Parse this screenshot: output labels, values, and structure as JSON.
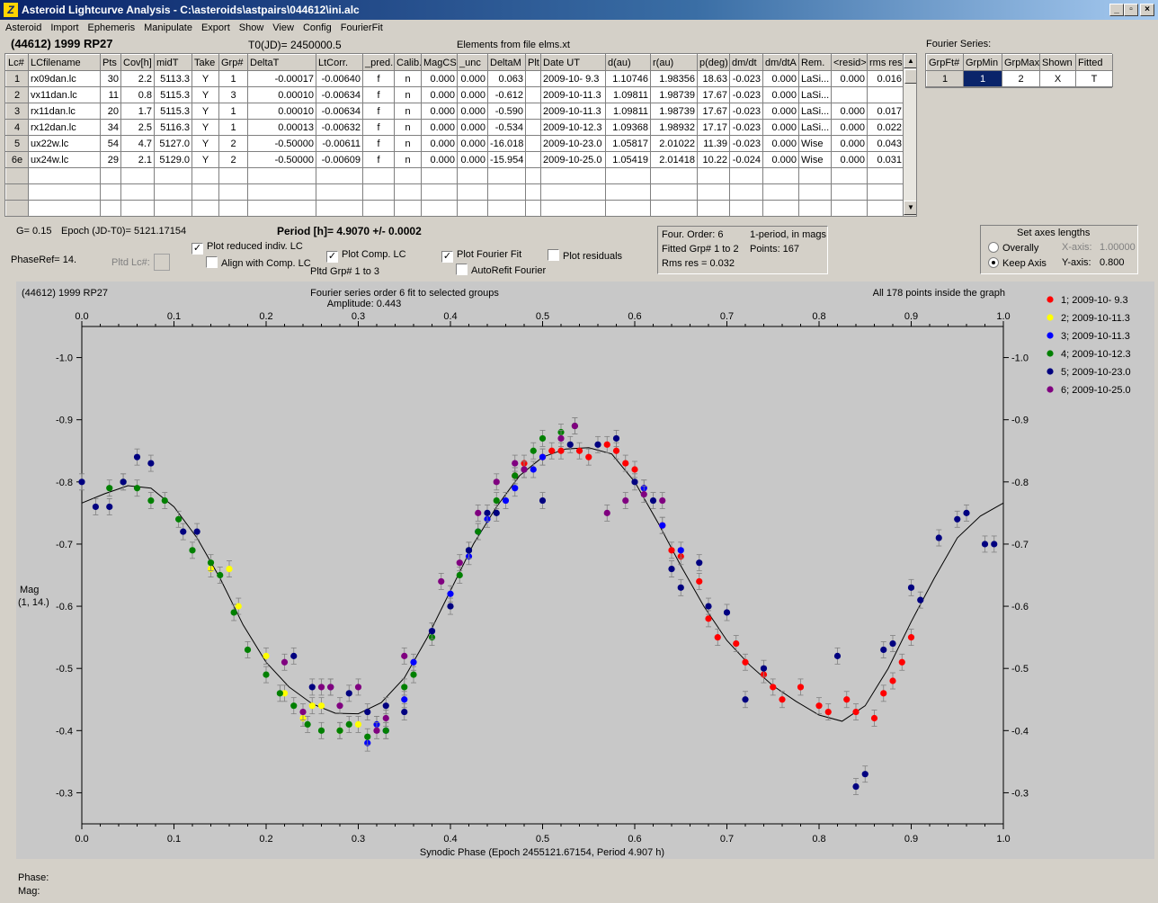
{
  "window": {
    "title": "Asteroid Lightcurve Analysis - C:\\asteroids\\astpairs\\044612\\ini.alc",
    "icon": "app-icon",
    "min": "_",
    "max": "▫",
    "close": "×"
  },
  "menu": [
    "Asteroid",
    "Import",
    "Ephemeris",
    "Manipulate",
    "Export",
    "Show",
    "View",
    "Config",
    "FourierFit"
  ],
  "header": {
    "asteroid": "(44612) 1999 RP27",
    "t0": "T0(JD)= 2450000.5",
    "elements": "Elements from file elms.xt"
  },
  "lc_table": {
    "headers": [
      "Lc#",
      "LCfilename",
      "Pts",
      "Cov[h]",
      "midT",
      "Take",
      "Grp#",
      "DeltaT",
      "LtCorr.",
      "_pred.",
      "Calib.",
      "MagCS",
      "_unc",
      "DeltaM",
      "Plt",
      "Date UT",
      "d(au)",
      "r(au)",
      "p(deg)",
      "dm/dt",
      "dm/dtA",
      "Rem.",
      "<resid>",
      "rms res"
    ],
    "rows": [
      [
        "1",
        "rx09dan.lc",
        "30",
        "2.2",
        "5113.3",
        "Y",
        "1",
        "-0.00017",
        "-0.00640",
        "f",
        "n",
        "0.000",
        "0.000",
        "0.063",
        "",
        "2009-10- 9.3",
        "1.10746",
        "1.98356",
        "18.63",
        "-0.023",
        "0.000",
        "LaSi...",
        "0.000",
        "0.016"
      ],
      [
        "2",
        "vx11dan.lc",
        "11",
        "0.8",
        "5115.3",
        "Y",
        "3",
        "0.00010",
        "-0.00634",
        "f",
        "n",
        "0.000",
        "0.000",
        "-0.612",
        "",
        "2009-10-11.3",
        "1.09811",
        "1.98739",
        "17.67",
        "-0.023",
        "0.000",
        "LaSi...",
        "",
        ""
      ],
      [
        "3",
        "rx11dan.lc",
        "20",
        "1.7",
        "5115.3",
        "Y",
        "1",
        "0.00010",
        "-0.00634",
        "f",
        "n",
        "0.000",
        "0.000",
        "-0.590",
        "",
        "2009-10-11.3",
        "1.09811",
        "1.98739",
        "17.67",
        "-0.023",
        "0.000",
        "LaSi...",
        "0.000",
        "0.017"
      ],
      [
        "4",
        "rx12dan.lc",
        "34",
        "2.5",
        "5116.3",
        "Y",
        "1",
        "0.00013",
        "-0.00632",
        "f",
        "n",
        "0.000",
        "0.000",
        "-0.534",
        "",
        "2009-10-12.3",
        "1.09368",
        "1.98932",
        "17.17",
        "-0.023",
        "0.000",
        "LaSi...",
        "0.000",
        "0.022"
      ],
      [
        "5",
        "ux22w.lc",
        "54",
        "4.7",
        "5127.0",
        "Y",
        "2",
        "-0.50000",
        "-0.00611",
        "f",
        "n",
        "0.000",
        "0.000",
        "-16.018",
        "",
        "2009-10-23.0",
        "1.05817",
        "2.01022",
        "11.39",
        "-0.023",
        "0.000",
        "Wise",
        "0.000",
        "0.043"
      ],
      [
        "6e",
        "ux24w.lc",
        "29",
        "2.1",
        "5129.0",
        "Y",
        "2",
        "-0.50000",
        "-0.00609",
        "f",
        "n",
        "0.000",
        "0.000",
        "-15.954",
        "",
        "2009-10-25.0",
        "1.05419",
        "2.01418",
        "10.22",
        "-0.024",
        "0.000",
        "Wise",
        "0.000",
        "0.031"
      ]
    ],
    "empty_rows": 3,
    "scroll_up": "▲",
    "scroll_down": "▼"
  },
  "fourier_panel": {
    "title": "Fourier Series:",
    "headers": [
      "GrpFt#",
      "GrpMin",
      "GrpMax",
      "Shown",
      "Fitted"
    ],
    "row": [
      "1",
      "1",
      "2",
      "X",
      "T"
    ]
  },
  "controls": {
    "g": "G= 0.15",
    "epoch": "Epoch (JD-T0)= 5121.17154",
    "period": "Period [h]= 4.9070 +/- 0.0002",
    "phaseref": "PhaseRef= 14.",
    "pltd_lc": "Pltd Lc#:",
    "plot_reduced": "Plot reduced indiv. LC",
    "align_comp": "Align with Comp. LC",
    "plot_comp": "Plot Comp. LC",
    "pltd_grp": "Pltd Grp#  1   to   3",
    "plot_fourier": "Plot Fourier Fit",
    "autorefit": "AutoRefit Fourier",
    "plot_residuals": "Plot residuals",
    "check": "✓"
  },
  "fit_info": {
    "order": "Four. Order:  6",
    "period_mode": "1-period, in mags",
    "fitted": "Fitted Grp# 1 to 2",
    "points": "Points: 167",
    "rms": "Rms res     = 0.032"
  },
  "axes_box": {
    "title": "Set axes lengths",
    "overally": "Overally",
    "keep": "Keep Axis",
    "xaxis_label": "X-axis:",
    "xaxis_val": "1.00000",
    "yaxis_label": "Y-axis:",
    "yaxis_val": "0.800"
  },
  "chart_data": {
    "type": "scatter",
    "title_left": "(44612) 1999 RP27",
    "title": "Fourier series order 6 fit to selected groups",
    "subtitle": "Amplitude: 0.443",
    "note": "All 178 points inside the graph",
    "xlabel": "Synodic Phase (Epoch 2455121.67154, Period 4.907 h)",
    "ylabel": "Mag",
    "ylabel2": "(1, 14.)",
    "xlim": [
      0,
      1
    ],
    "ylim": [
      -1.05,
      -0.25
    ],
    "y_inverted": true,
    "xticks": [
      0,
      0.1,
      0.2,
      0.3,
      0.4,
      0.5,
      0.6,
      0.7,
      0.8,
      0.9,
      1.0
    ],
    "xtick_labels": [
      "0.0",
      "0.1",
      "0.2",
      "0.3",
      "0.4",
      "0.5",
      "0.6",
      "0.7",
      "0.8",
      "0.9",
      "1.0"
    ],
    "yticks": [
      -1.0,
      -0.9,
      -0.8,
      -0.7,
      -0.6,
      -0.5,
      -0.4,
      -0.3
    ],
    "ytick_labels": [
      "-1.0",
      "-0.9",
      "-0.8",
      "-0.7",
      "-0.6",
      "-0.5",
      "-0.4",
      "-0.3"
    ],
    "legend": "right",
    "series": [
      {
        "name": "1; 2009-10- 9.3",
        "color": "#ff0000",
        "points": [
          [
            0.47,
            -0.81
          ],
          [
            0.48,
            -0.83
          ],
          [
            0.5,
            -0.84
          ],
          [
            0.51,
            -0.85
          ],
          [
            0.52,
            -0.85
          ],
          [
            0.54,
            -0.85
          ],
          [
            0.55,
            -0.84
          ],
          [
            0.57,
            -0.86
          ],
          [
            0.58,
            -0.85
          ],
          [
            0.59,
            -0.83
          ],
          [
            0.6,
            -0.82
          ],
          [
            0.61,
            -0.79
          ],
          [
            0.63,
            -0.73
          ],
          [
            0.64,
            -0.69
          ],
          [
            0.65,
            -0.68
          ],
          [
            0.67,
            -0.64
          ],
          [
            0.68,
            -0.58
          ],
          [
            0.69,
            -0.55
          ],
          [
            0.71,
            -0.54
          ],
          [
            0.72,
            -0.51
          ],
          [
            0.74,
            -0.49
          ],
          [
            0.75,
            -0.47
          ],
          [
            0.76,
            -0.45
          ],
          [
            0.78,
            -0.47
          ],
          [
            0.8,
            -0.44
          ],
          [
            0.81,
            -0.43
          ],
          [
            0.83,
            -0.45
          ],
          [
            0.84,
            -0.43
          ],
          [
            0.86,
            -0.42
          ],
          [
            0.87,
            -0.46
          ],
          [
            0.88,
            -0.48
          ],
          [
            0.89,
            -0.51
          ],
          [
            0.9,
            -0.55
          ]
        ]
      },
      {
        "name": "2; 2009-10-11.3",
        "color": "#ffff00",
        "points": [
          [
            0.14,
            -0.66
          ],
          [
            0.16,
            -0.66
          ],
          [
            0.17,
            -0.6
          ],
          [
            0.2,
            -0.52
          ],
          [
            0.22,
            -0.46
          ],
          [
            0.24,
            -0.42
          ],
          [
            0.25,
            -0.44
          ],
          [
            0.26,
            -0.44
          ],
          [
            0.28,
            -0.4
          ],
          [
            0.3,
            -0.41
          ],
          [
            0.32,
            -0.41
          ]
        ]
      },
      {
        "name": "3; 2009-10-11.3",
        "color": "#0000ff",
        "points": [
          [
            0.33,
            -0.4
          ],
          [
            0.35,
            -0.45
          ],
          [
            0.36,
            -0.51
          ],
          [
            0.38,
            -0.56
          ],
          [
            0.4,
            -0.62
          ],
          [
            0.42,
            -0.68
          ],
          [
            0.43,
            -0.72
          ],
          [
            0.44,
            -0.74
          ],
          [
            0.46,
            -0.77
          ],
          [
            0.47,
            -0.79
          ],
          [
            0.49,
            -0.82
          ],
          [
            0.5,
            -0.84
          ],
          [
            0.61,
            -0.79
          ],
          [
            0.63,
            -0.73
          ],
          [
            0.65,
            -0.69
          ],
          [
            0.31,
            -0.38
          ],
          [
            0.32,
            -0.41
          ]
        ]
      },
      {
        "name": "4; 2009-10-12.3",
        "color": "#008000",
        "points": [
          [
            0.03,
            -0.79
          ],
          [
            0.045,
            -0.8
          ],
          [
            0.06,
            -0.79
          ],
          [
            0.075,
            -0.77
          ],
          [
            0.09,
            -0.77
          ],
          [
            0.105,
            -0.74
          ],
          [
            0.12,
            -0.69
          ],
          [
            0.14,
            -0.67
          ],
          [
            0.15,
            -0.65
          ],
          [
            0.165,
            -0.59
          ],
          [
            0.18,
            -0.53
          ],
          [
            0.2,
            -0.49
          ],
          [
            0.215,
            -0.46
          ],
          [
            0.23,
            -0.44
          ],
          [
            0.245,
            -0.41
          ],
          [
            0.26,
            -0.4
          ],
          [
            0.28,
            -0.4
          ],
          [
            0.29,
            -0.41
          ],
          [
            0.31,
            -0.39
          ],
          [
            0.33,
            -0.4
          ],
          [
            0.35,
            -0.47
          ],
          [
            0.36,
            -0.49
          ],
          [
            0.38,
            -0.55
          ],
          [
            0.41,
            -0.65
          ],
          [
            0.42,
            -0.69
          ],
          [
            0.43,
            -0.72
          ],
          [
            0.45,
            -0.77
          ],
          [
            0.47,
            -0.81
          ],
          [
            0.49,
            -0.85
          ],
          [
            0.5,
            -0.87
          ],
          [
            0.52,
            -0.88
          ],
          [
            0.535,
            -0.89
          ]
        ]
      },
      {
        "name": "5; 2009-10-23.0",
        "color": "#000080",
        "points": [
          [
            0.0,
            -0.8
          ],
          [
            0.015,
            -0.76
          ],
          [
            0.03,
            -0.76
          ],
          [
            0.045,
            -0.8
          ],
          [
            0.06,
            -0.84
          ],
          [
            0.075,
            -0.83
          ],
          [
            0.11,
            -0.72
          ],
          [
            0.125,
            -0.72
          ],
          [
            0.23,
            -0.52
          ],
          [
            0.25,
            -0.47
          ],
          [
            0.27,
            -0.47
          ],
          [
            0.29,
            -0.46
          ],
          [
            0.31,
            -0.43
          ],
          [
            0.33,
            -0.44
          ],
          [
            0.35,
            -0.43
          ],
          [
            0.38,
            -0.56
          ],
          [
            0.4,
            -0.6
          ],
          [
            0.42,
            -0.69
          ],
          [
            0.44,
            -0.75
          ],
          [
            0.45,
            -0.75
          ],
          [
            0.48,
            -0.82
          ],
          [
            0.5,
            -0.77
          ],
          [
            0.53,
            -0.86
          ],
          [
            0.56,
            -0.86
          ],
          [
            0.58,
            -0.87
          ],
          [
            0.6,
            -0.8
          ],
          [
            0.62,
            -0.77
          ],
          [
            0.64,
            -0.66
          ],
          [
            0.65,
            -0.63
          ],
          [
            0.67,
            -0.67
          ],
          [
            0.68,
            -0.6
          ],
          [
            0.7,
            -0.59
          ],
          [
            0.72,
            -0.45
          ],
          [
            0.74,
            -0.5
          ],
          [
            0.82,
            -0.52
          ],
          [
            0.84,
            -0.31
          ],
          [
            0.85,
            -0.33
          ],
          [
            0.87,
            -0.53
          ],
          [
            0.88,
            -0.54
          ],
          [
            0.9,
            -0.63
          ],
          [
            0.91,
            -0.61
          ],
          [
            0.93,
            -0.71
          ],
          [
            0.95,
            -0.74
          ],
          [
            0.96,
            -0.75
          ],
          [
            0.98,
            -0.7
          ],
          [
            0.99,
            -0.7
          ]
        ]
      },
      {
        "name": "6; 2009-10-25.0",
        "color": "#800080",
        "points": [
          [
            0.22,
            -0.51
          ],
          [
            0.24,
            -0.43
          ],
          [
            0.26,
            -0.47
          ],
          [
            0.27,
            -0.47
          ],
          [
            0.28,
            -0.44
          ],
          [
            0.3,
            -0.47
          ],
          [
            0.32,
            -0.4
          ],
          [
            0.33,
            -0.42
          ],
          [
            0.35,
            -0.52
          ],
          [
            0.39,
            -0.64
          ],
          [
            0.41,
            -0.67
          ],
          [
            0.43,
            -0.75
          ],
          [
            0.45,
            -0.8
          ],
          [
            0.47,
            -0.83
          ],
          [
            0.48,
            -0.82
          ],
          [
            0.52,
            -0.87
          ],
          [
            0.535,
            -0.89
          ],
          [
            0.57,
            -0.75
          ],
          [
            0.59,
            -0.77
          ],
          [
            0.61,
            -0.78
          ],
          [
            0.63,
            -0.77
          ]
        ]
      }
    ],
    "fit_curve": {
      "x": [
        0,
        0.025,
        0.05,
        0.075,
        0.1,
        0.125,
        0.15,
        0.175,
        0.2,
        0.225,
        0.25,
        0.275,
        0.3,
        0.325,
        0.35,
        0.375,
        0.4,
        0.425,
        0.45,
        0.475,
        0.5,
        0.525,
        0.55,
        0.575,
        0.6,
        0.625,
        0.65,
        0.675,
        0.7,
        0.725,
        0.75,
        0.775,
        0.8,
        0.825,
        0.85,
        0.875,
        0.9,
        0.925,
        0.95,
        0.975,
        1.0
      ],
      "y": [
        -0.766,
        -0.781,
        -0.794,
        -0.79,
        -0.76,
        -0.71,
        -0.645,
        -0.57,
        -0.51,
        -0.47,
        -0.443,
        -0.428,
        -0.427,
        -0.445,
        -0.485,
        -0.55,
        -0.625,
        -0.7,
        -0.76,
        -0.81,
        -0.84,
        -0.853,
        -0.855,
        -0.845,
        -0.8,
        -0.735,
        -0.665,
        -0.6,
        -0.545,
        -0.505,
        -0.472,
        -0.447,
        -0.425,
        -0.415,
        -0.44,
        -0.5,
        -0.575,
        -0.645,
        -0.71,
        -0.745,
        -0.766
      ]
    }
  },
  "status": {
    "phase": "Phase:",
    "mag": "Mag:"
  }
}
